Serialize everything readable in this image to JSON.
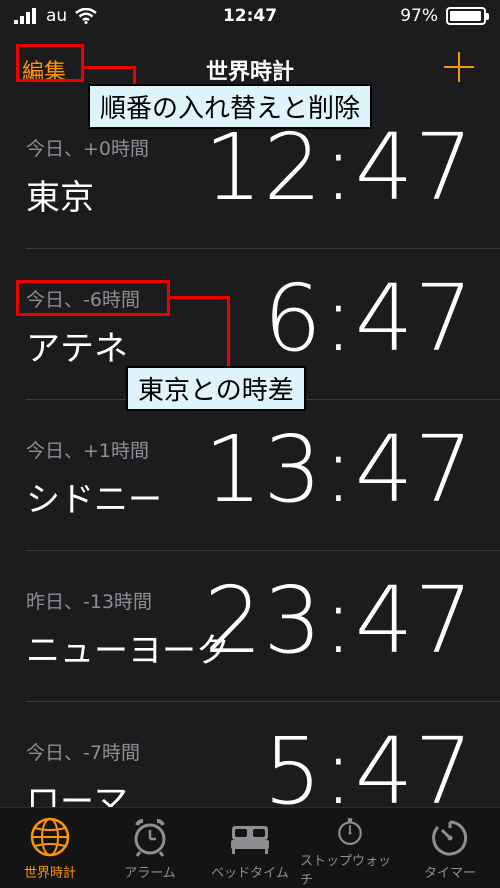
{
  "status": {
    "carrier": "au",
    "time": "12:47",
    "battery_percent": "97%",
    "battery_level": 0.97
  },
  "nav": {
    "edit_label": "編集",
    "title": "世界時計",
    "add_icon": "plus-icon"
  },
  "clocks": [
    {
      "offset": "今日、+0時間",
      "city": "東京",
      "time": "12:47"
    },
    {
      "offset": "今日、-6時間",
      "city": "アテネ",
      "time": "6:47"
    },
    {
      "offset": "今日、+1時間",
      "city": "シドニー",
      "time": "13:47"
    },
    {
      "offset": "昨日、-13時間",
      "city": "ニューヨーク",
      "time": "23:47"
    },
    {
      "offset": "今日、-7時間",
      "city": "ローマ",
      "time": "5:47"
    }
  ],
  "tabs": [
    {
      "label": "世界時計",
      "icon": "globe-icon",
      "active": true
    },
    {
      "label": "アラーム",
      "icon": "alarm-clock-icon",
      "active": false
    },
    {
      "label": "ベッドタイム",
      "icon": "bed-icon",
      "active": false
    },
    {
      "label": "ストップウォッチ",
      "icon": "stopwatch-icon",
      "active": false
    },
    {
      "label": "タイマー",
      "icon": "timer-icon",
      "active": false
    }
  ],
  "annotations": {
    "edit_callout": "順番の入れ替えと削除",
    "offset_callout": "東京との時差",
    "highlight_color": "#e00000",
    "callout_bg": "#dff3fa"
  },
  "colors": {
    "accent": "#ff9500",
    "background": "#1c1c1e"
  }
}
